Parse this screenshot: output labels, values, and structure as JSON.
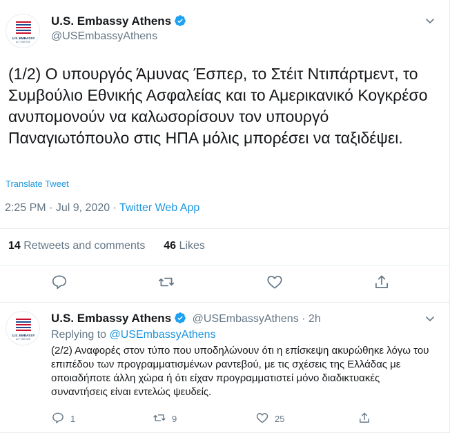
{
  "main_tweet": {
    "display_name": "U.S. Embassy Athens",
    "handle": "@USEmbassyAthens",
    "avatar_text_line1": "U.S. EMBASSY",
    "avatar_text_line2": "ATHENS",
    "text": "(1/2) Ο υπουργός Άμυνας Έσπερ, το Στέιτ Ντιπάρτμεντ, το Συμβούλιο Εθνικής Ασφαλείας και το Αμερικανικό Κογκρέσο ανυπομονούν να καλωσορίσουν τον υπουργό Παναγιωτόπουλο στις ΗΠΑ μόλις μπορέσει να ταξιδέψει.",
    "translate_label": "Translate Tweet",
    "time": "2:25 PM",
    "date": "Jul 9, 2020",
    "separator": "·",
    "app": "Twitter Web App",
    "retweets_count": "14",
    "retweets_label": "Retweets and comments",
    "likes_count": "46",
    "likes_label": "Likes",
    "icons": [
      "reply-icon",
      "retweet-icon",
      "like-icon",
      "share-icon"
    ]
  },
  "reply_tweet": {
    "display_name": "U.S. Embassy Athens",
    "handle": "@USEmbassyAthens",
    "separator": "·",
    "age": "2h",
    "replying_label": "Replying to",
    "replying_to": "@USEmbassyAthens",
    "avatar_text_line1": "U.S. EMBASSY",
    "avatar_text_line2": "ATHENS",
    "text": "(2/2) Αναφορές στον τύπο που υποδηλώνουν ότι η επίσκεψη ακυρώθηκε λόγω του επιπέδου των προγραμματισμένων ραντεβού, με τις σχέσεις της Ελλάδας με οποιαδήποτε άλλη χώρα ή ότι είχαν προγραμματιστεί μόνο διαδικτυακές συναντήσεις είναι εντελώς ψευδείς.",
    "reply_count": "1",
    "retweet_count": "9",
    "like_count": "25"
  },
  "colors": {
    "accent": "#1b95e0",
    "muted": "#657786",
    "text": "#14171a",
    "divider": "#e6ecf0",
    "flag_red": "#c8102e",
    "flag_blue": "#0a3161"
  }
}
